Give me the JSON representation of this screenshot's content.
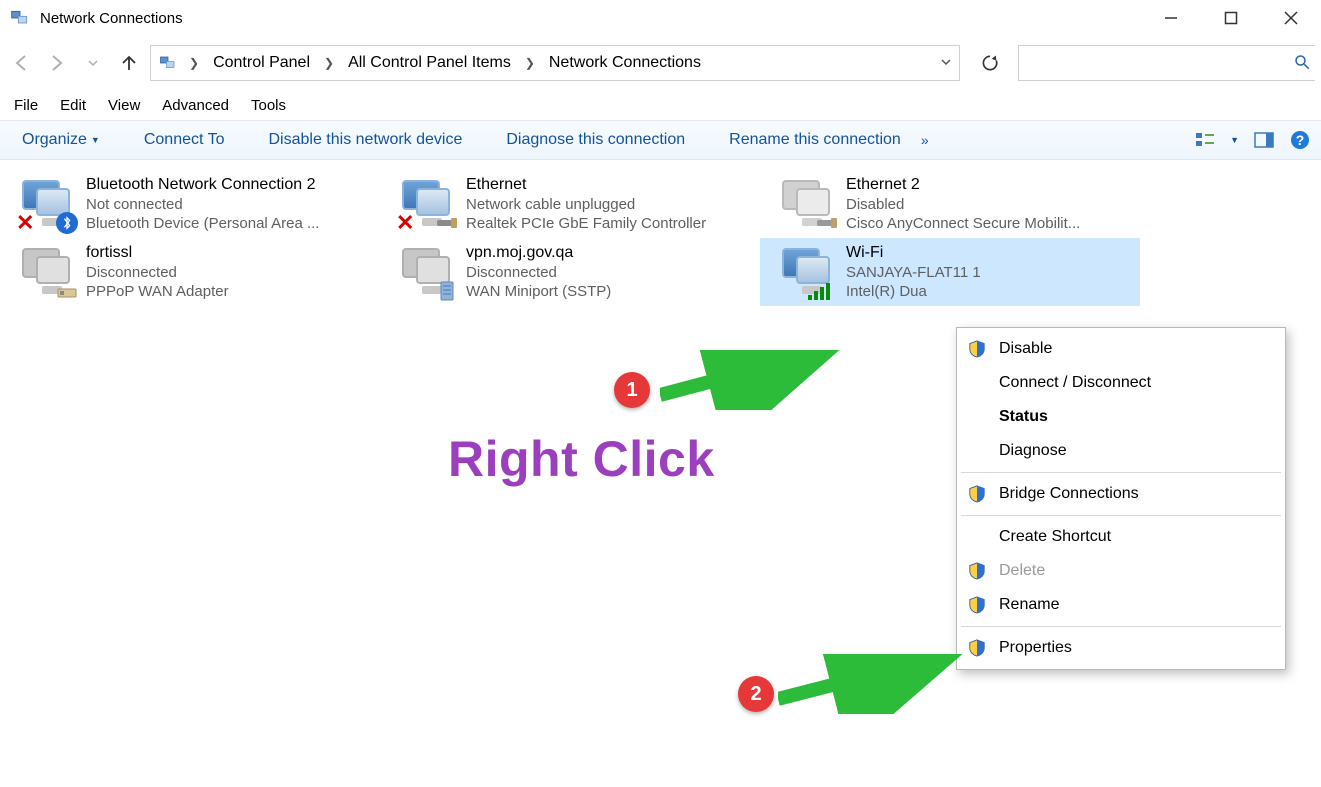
{
  "window": {
    "title": "Network Connections"
  },
  "breadcrumbs": [
    "Control Panel",
    "All Control Panel Items",
    "Network Connections"
  ],
  "menubar": [
    "File",
    "Edit",
    "View",
    "Advanced",
    "Tools"
  ],
  "toolbar": {
    "organize": "Organize",
    "connect_to": "Connect To",
    "disable_device": "Disable this network device",
    "diagnose": "Diagnose this connection",
    "rename": "Rename this connection"
  },
  "search": {
    "placeholder": ""
  },
  "connections": [
    {
      "name": "Bluetooth Network Connection 2",
      "status": "Not connected",
      "device": "Bluetooth Device (Personal Area ...",
      "overlay": "bluetooth",
      "error": true
    },
    {
      "name": "Ethernet",
      "status": "Network cable unplugged",
      "device": "Realtek PCIe GbE Family Controller",
      "overlay": "cable",
      "error": true
    },
    {
      "name": "Ethernet 2",
      "status": "Disabled",
      "device": "Cisco AnyConnect Secure Mobilit...",
      "overlay": "cable",
      "error": false
    },
    {
      "name": "fortissl",
      "status": "Disconnected",
      "device": "PPPoP WAN Adapter",
      "overlay": "modem",
      "error": false
    },
    {
      "name": "vpn.moj.gov.qa",
      "status": "Disconnected",
      "device": "WAN Miniport (SSTP)",
      "overlay": "server",
      "error": false
    },
    {
      "name": "Wi-Fi",
      "status": "SANJAYA-FLAT11 1",
      "device": "Intel(R) Dua",
      "overlay": "wifi",
      "error": false,
      "selected": true
    }
  ],
  "context_menu": {
    "disable": "Disable",
    "connect_disconnect": "Connect / Disconnect",
    "status": "Status",
    "diagnose": "Diagnose",
    "bridge": "Bridge Connections",
    "create_shortcut": "Create Shortcut",
    "delete": "Delete",
    "rename": "Rename",
    "properties": "Properties"
  },
  "annotation": {
    "text": "Right Click",
    "badge1": "1",
    "badge2": "2"
  }
}
